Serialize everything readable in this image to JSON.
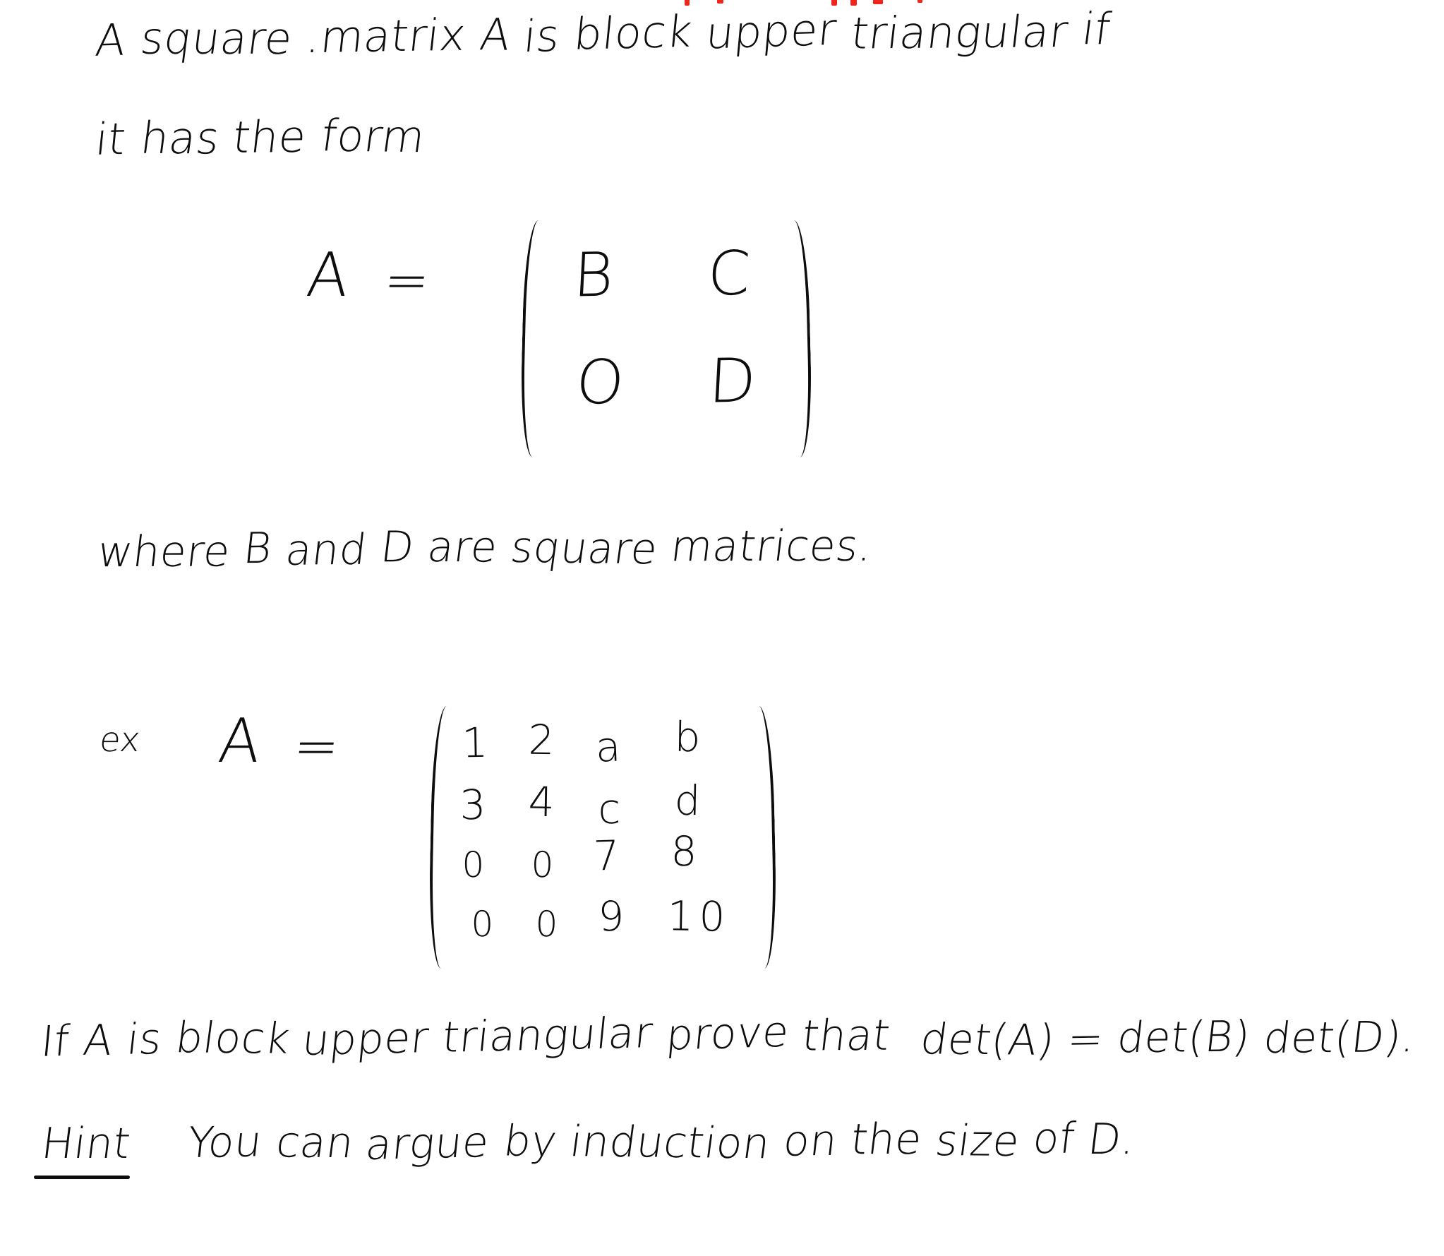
{
  "document": {
    "kind": "handwritten-math-worksheet",
    "ink_color": "#0d0d0d",
    "accent_color": "#f0251c",
    "background_color": "#ffffff"
  },
  "definition": {
    "line1": "A   square  .matrix   A   is   block   upper  triangular  if",
    "line2": "it   has   the   form"
  },
  "block_form": {
    "lhs": "A",
    "equals": "=",
    "open_paren": "(",
    "close_paren": ")",
    "entries": [
      [
        "B",
        "C"
      ],
      [
        "O",
        "D"
      ]
    ]
  },
  "condition": {
    "text": "where   B   and  D   are   square   matrices."
  },
  "example": {
    "label": "ex",
    "lhs": "A",
    "equals": "=",
    "open_paren": "(",
    "close_paren": ")",
    "rows": [
      [
        "1",
        "2",
        "a",
        "b"
      ],
      [
        "3",
        "4",
        "c",
        "d"
      ],
      [
        "0",
        "0",
        "7",
        "8"
      ],
      [
        "0",
        "0",
        "9",
        "10"
      ]
    ]
  },
  "problem": {
    "statement_prefix": "If  A   is   block  upper  triangular  prove  that",
    "equation": "det(A) = det(B) det(D).",
    "hint_label": "Hint",
    "hint_text": "You  can  argue  by  induction  on  the  size  of  D."
  }
}
